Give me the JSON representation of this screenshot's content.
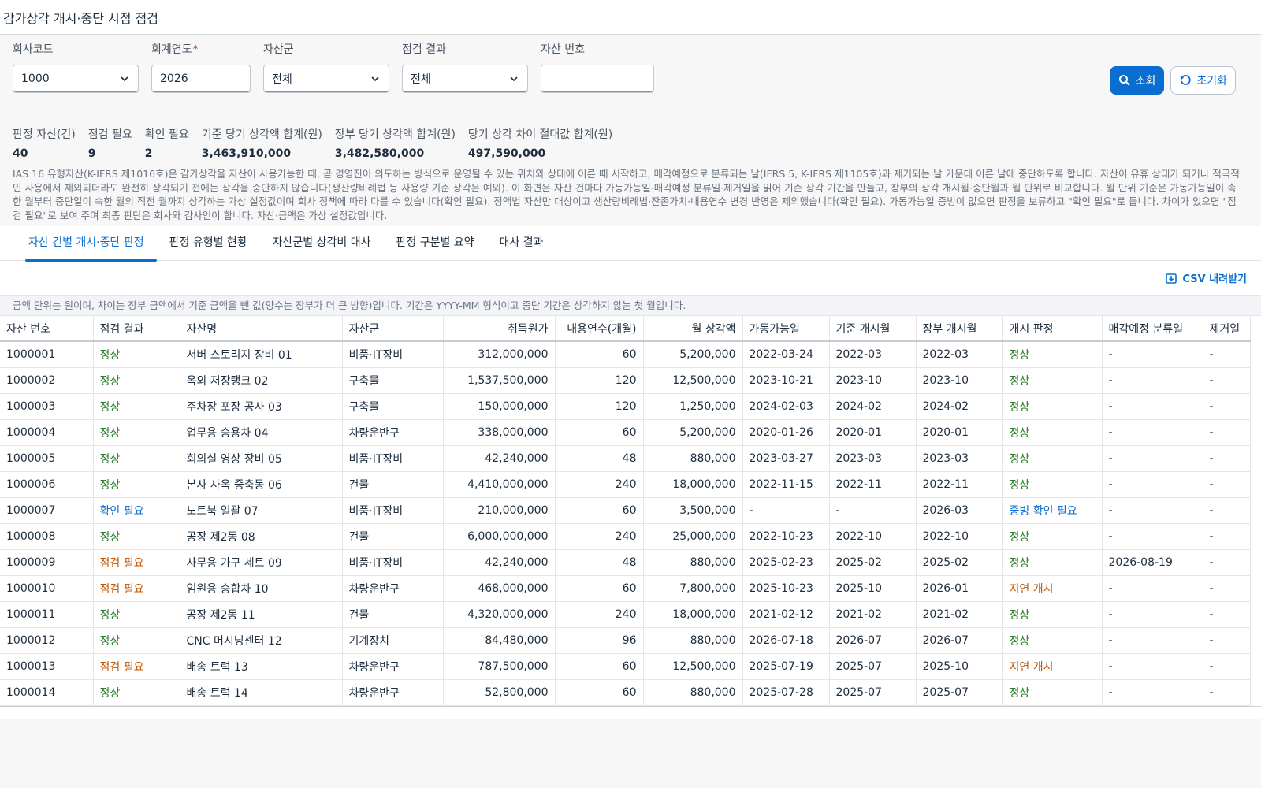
{
  "page": {
    "title": "감가상각 개시·중단 시점 점검"
  },
  "filters": {
    "company_code": {
      "label": "회사코드",
      "value": "1000"
    },
    "fiscal_year": {
      "label": "회계연도",
      "required_mark": "*",
      "value": "2026"
    },
    "asset_class": {
      "label": "자산군",
      "value": "전체"
    },
    "check_result": {
      "label": "점검 결과",
      "value": "전체"
    },
    "asset_no": {
      "label": "자산 번호",
      "value": ""
    }
  },
  "actions": {
    "search_label": "조회",
    "reset_label": "초기화"
  },
  "kpis": [
    {
      "label": "판정 자산(건)",
      "value": "40"
    },
    {
      "label": "점검 필요",
      "value": "9"
    },
    {
      "label": "확인 필요",
      "value": "2"
    },
    {
      "label": "기준 당기 상각액 합계(원)",
      "value": "3,463,910,000"
    },
    {
      "label": "장부 당기 상각액 합계(원)",
      "value": "3,482,580,000"
    },
    {
      "label": "당기 상각 차이 절대값 합계(원)",
      "value": "497,590,000"
    }
  ],
  "description": "IAS 16 유형자산(K-IFRS 제1016호)은 감가상각을 자산이 사용가능한 때, 곧 경영진이 의도하는 방식으로 운영될 수 있는 위치와 상태에 이른 때 시작하고, 매각예정으로 분류되는 날(IFRS 5, K-IFRS 제1105호)과 제거되는 날 가운데 이른 날에 중단하도록 합니다. 자산이 유휴 상태가 되거나 적극적인 사용에서 제외되더라도 완전히 상각되기 전에는 상각을 중단하지 않습니다(생산량비례법 등 사용량 기준 상각은 예외). 이 화면은 자산 건마다 가동가능일·매각예정 분류일·제거일을 읽어 기준 상각 기간을 만들고, 장부의 상각 개시월·중단월과 월 단위로 비교합니다. 월 단위 기준은 가동가능일이 속한 월부터 중단일이 속한 월의 직전 월까지 상각하는 가상 설정값이며 회사 정책에 따라 다를 수 있습니다(확인 필요). 정액법 자산만 대상이고 생산량비례법·잔존가치·내용연수 변경 반영은 제외했습니다(확인 필요). 가동가능일 증빙이 없으면 판정을 보류하고 \"확인 필요\"로 둡니다. 차이가 있으면 \"점검 필요\"로 보여 주며 최종 판단은 회사와 감사인이 합니다. 자산·금액은 가상 설정값입니다.",
  "tabs": [
    {
      "label": "자산 건별 개시·중단 판정",
      "active": true
    },
    {
      "label": "판정 유형별 현황",
      "active": false
    },
    {
      "label": "자산군별 상각비 대사",
      "active": false
    },
    {
      "label": "판정 구분별 요약",
      "active": false
    },
    {
      "label": "대사 결과",
      "active": false
    }
  ],
  "toolbar": {
    "csv_label": "CSV 내려받기"
  },
  "note": "금액 단위는 원이며, 차이는 장부 금액에서 기준 금액을 뺀 값(양수는 장부가 더 큰 방향)입니다. 기간은 YYYY-MM 형식이고 중단 기간은 상각하지 않는 첫 월입니다.",
  "table": {
    "columns": [
      "자산 번호",
      "점검 결과",
      "자산명",
      "자산군",
      "취득원가",
      "내용연수(개월)",
      "월 상각액",
      "가동가능일",
      "기준 개시월",
      "장부 개시월",
      "개시 판정",
      "매각예정 분류일",
      "제거일"
    ],
    "rows": [
      {
        "asset_no": "1000001",
        "result": "정상",
        "name": "서버 스토리지 장비 01",
        "group": "비품·IT장비",
        "cost": "312,000,000",
        "life": "60",
        "monthly": "5,200,000",
        "avail": "2022-03-24",
        "base_start": "2022-03",
        "book_start": "2022-03",
        "judge": "정상",
        "held_for_sale": "-",
        "derecog": "-"
      },
      {
        "asset_no": "1000002",
        "result": "정상",
        "name": "옥외 저장탱크 02",
        "group": "구축물",
        "cost": "1,537,500,000",
        "life": "120",
        "monthly": "12,500,000",
        "avail": "2023-10-21",
        "base_start": "2023-10",
        "book_start": "2023-10",
        "judge": "정상",
        "held_for_sale": "-",
        "derecog": "-"
      },
      {
        "asset_no": "1000003",
        "result": "정상",
        "name": "주차장 포장 공사 03",
        "group": "구축물",
        "cost": "150,000,000",
        "life": "120",
        "monthly": "1,250,000",
        "avail": "2024-02-03",
        "base_start": "2024-02",
        "book_start": "2024-02",
        "judge": "정상",
        "held_for_sale": "-",
        "derecog": "-"
      },
      {
        "asset_no": "1000004",
        "result": "정상",
        "name": "업무용 승용차 04",
        "group": "차량운반구",
        "cost": "338,000,000",
        "life": "60",
        "monthly": "5,200,000",
        "avail": "2020-01-26",
        "base_start": "2020-01",
        "book_start": "2020-01",
        "judge": "정상",
        "held_for_sale": "-",
        "derecog": "-"
      },
      {
        "asset_no": "1000005",
        "result": "정상",
        "name": "회의실 영상 장비 05",
        "group": "비품·IT장비",
        "cost": "42,240,000",
        "life": "48",
        "monthly": "880,000",
        "avail": "2023-03-27",
        "base_start": "2023-03",
        "book_start": "2023-03",
        "judge": "정상",
        "held_for_sale": "-",
        "derecog": "-"
      },
      {
        "asset_no": "1000006",
        "result": "정상",
        "name": "본사 사옥 증축동 06",
        "group": "건물",
        "cost": "4,410,000,000",
        "life": "240",
        "monthly": "18,000,000",
        "avail": "2022-11-15",
        "base_start": "2022-11",
        "book_start": "2022-11",
        "judge": "정상",
        "held_for_sale": "-",
        "derecog": "-"
      },
      {
        "asset_no": "1000007",
        "result": "확인 필요",
        "name": "노트북 일괄 07",
        "group": "비품·IT장비",
        "cost": "210,000,000",
        "life": "60",
        "monthly": "3,500,000",
        "avail": "-",
        "base_start": "-",
        "book_start": "2026-03",
        "judge": "증빙 확인 필요",
        "held_for_sale": "-",
        "derecog": "-"
      },
      {
        "asset_no": "1000008",
        "result": "정상",
        "name": "공장 제2동 08",
        "group": "건물",
        "cost": "6,000,000,000",
        "life": "240",
        "monthly": "25,000,000",
        "avail": "2022-10-23",
        "base_start": "2022-10",
        "book_start": "2022-10",
        "judge": "정상",
        "held_for_sale": "-",
        "derecog": "-"
      },
      {
        "asset_no": "1000009",
        "result": "점검 필요",
        "name": "사무용 가구 세트 09",
        "group": "비품·IT장비",
        "cost": "42,240,000",
        "life": "48",
        "monthly": "880,000",
        "avail": "2025-02-23",
        "base_start": "2025-02",
        "book_start": "2025-02",
        "judge": "정상",
        "held_for_sale": "2026-08-19",
        "derecog": "-"
      },
      {
        "asset_no": "1000010",
        "result": "점검 필요",
        "name": "임원용 승합차 10",
        "group": "차량운반구",
        "cost": "468,000,000",
        "life": "60",
        "monthly": "7,800,000",
        "avail": "2025-10-23",
        "base_start": "2025-10",
        "book_start": "2026-01",
        "judge": "지연 개시",
        "held_for_sale": "-",
        "derecog": "-"
      },
      {
        "asset_no": "1000011",
        "result": "정상",
        "name": "공장 제2동 11",
        "group": "건물",
        "cost": "4,320,000,000",
        "life": "240",
        "monthly": "18,000,000",
        "avail": "2021-02-12",
        "base_start": "2021-02",
        "book_start": "2021-02",
        "judge": "정상",
        "held_for_sale": "-",
        "derecog": "-"
      },
      {
        "asset_no": "1000012",
        "result": "정상",
        "name": "CNC 머시닝센터 12",
        "group": "기계장치",
        "cost": "84,480,000",
        "life": "96",
        "monthly": "880,000",
        "avail": "2026-07-18",
        "base_start": "2026-07",
        "book_start": "2026-07",
        "judge": "정상",
        "held_for_sale": "-",
        "derecog": "-"
      },
      {
        "asset_no": "1000013",
        "result": "점검 필요",
        "name": "배송 트럭 13",
        "group": "차량운반구",
        "cost": "787,500,000",
        "life": "60",
        "monthly": "12,500,000",
        "avail": "2025-07-19",
        "base_start": "2025-07",
        "book_start": "2025-10",
        "judge": "지연 개시",
        "held_for_sale": "-",
        "derecog": "-"
      },
      {
        "asset_no": "1000014",
        "result": "정상",
        "name": "배송 트럭 14",
        "group": "차량운반구",
        "cost": "52,800,000",
        "life": "60",
        "monthly": "880,000",
        "avail": "2025-07-28",
        "base_start": "2025-07",
        "book_start": "2025-07",
        "judge": "정상",
        "held_for_sale": "-",
        "derecog": "-"
      }
    ]
  },
  "status_colors": {
    "정상": "#2b7d2b",
    "확인 필요": "#0a6ed1",
    "점검 필요": "#c35500",
    "증빙 확인 필요": "#0a6ed1",
    "지연 개시": "#c35500"
  }
}
